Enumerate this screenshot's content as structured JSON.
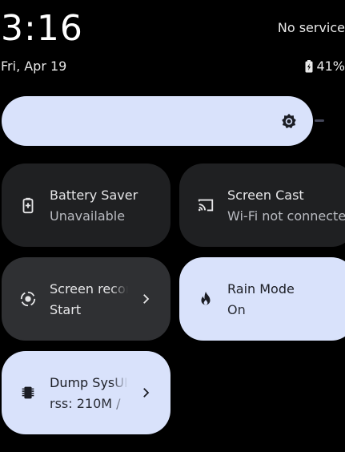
{
  "status": {
    "time": "3:16",
    "date": "Fri, Apr 19",
    "service": "No service",
    "battery_percent": "41%"
  },
  "brightness": {
    "level": 0.93
  },
  "tiles": {
    "battery_saver": {
      "title": "Battery Saver",
      "subtitle": "Unavailable",
      "icon": "battery-saver-icon"
    },
    "screen_cast": {
      "title": "Screen Cast",
      "subtitle": "Wi-Fi not connected",
      "icon": "cast-icon"
    },
    "screen_record": {
      "title": "Screen record",
      "subtitle": "Start",
      "icon": "screen-record-icon"
    },
    "rain_mode": {
      "title": "Rain Mode",
      "subtitle": "On",
      "icon": "flame-icon"
    },
    "dump_sysui": {
      "title": "Dump SysUI",
      "subtitle": "rss: 210M / ",
      "icon": "chip-icon"
    }
  },
  "colors": {
    "active_tile": "#d9e2fb",
    "inactive_tile": "#1f2022",
    "secondary_tile": "#2f3033",
    "background": "#000000"
  }
}
